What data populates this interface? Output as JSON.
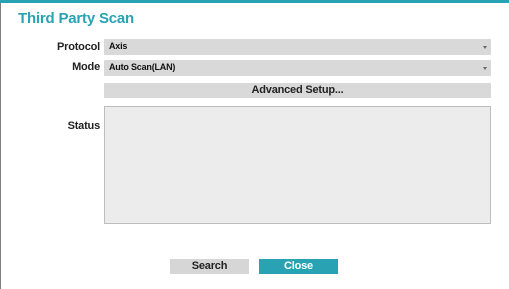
{
  "dialog": {
    "title": "Third Party Scan",
    "accent_color": "#29a3b3"
  },
  "form": {
    "protocol_label": "Protocol",
    "protocol_value": "Axis",
    "mode_label": "Mode",
    "mode_value": "Auto Scan(LAN)",
    "advanced_button": "Advanced Setup...",
    "status_label": "Status",
    "status_text": ""
  },
  "footer": {
    "search_label": "Search",
    "close_label": "Close"
  }
}
